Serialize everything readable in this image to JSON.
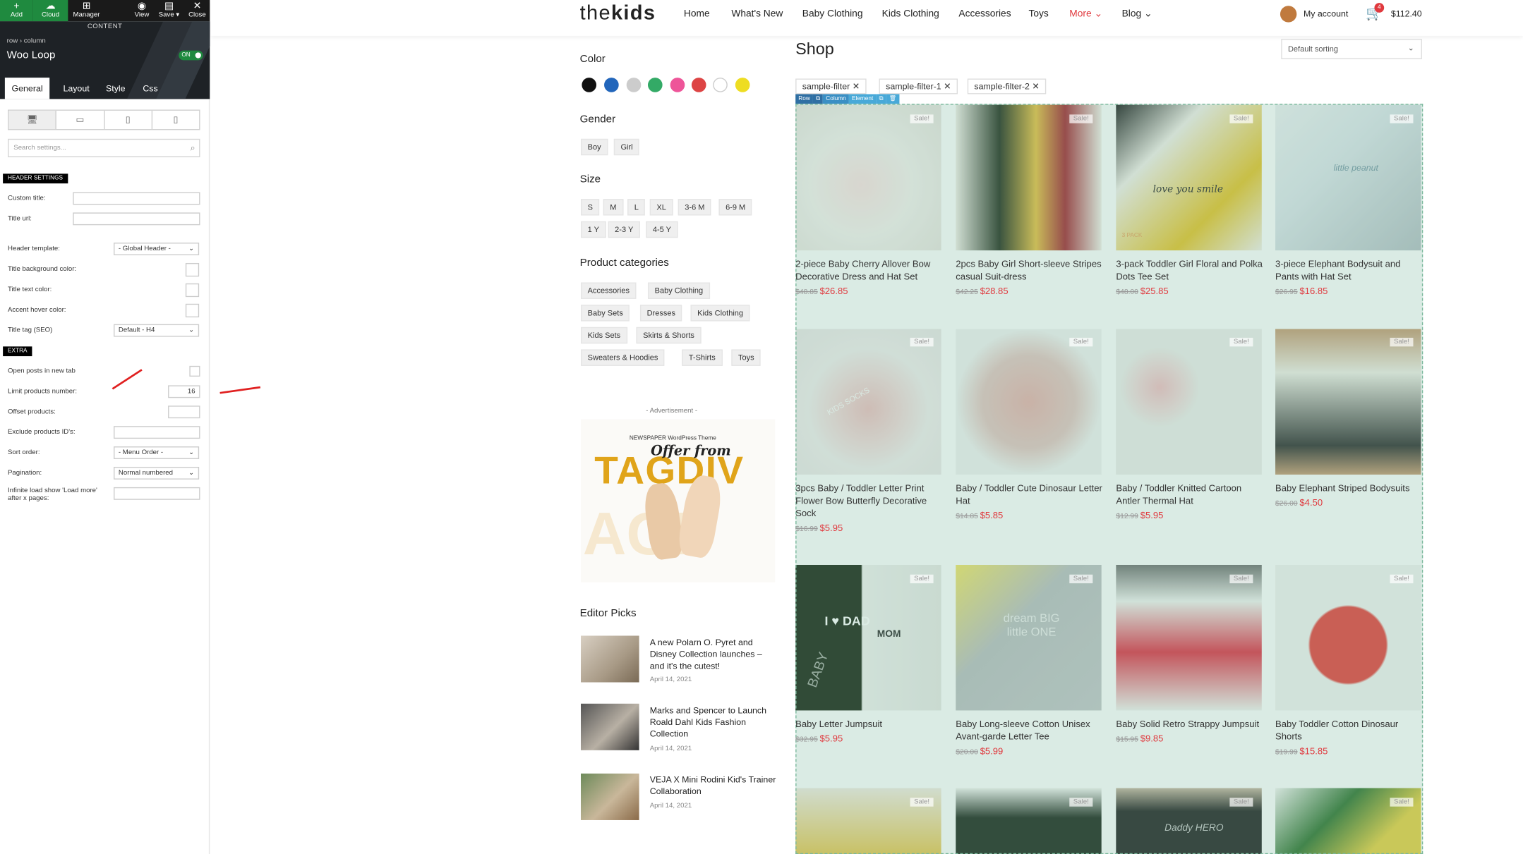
{
  "toolbar": {
    "add": "Add",
    "cloud": "Cloud",
    "manager": "Manager",
    "view": "View",
    "save": "Save ▾",
    "close": "Close"
  },
  "editor": {
    "content_label": "CONTENT",
    "breadcrumb": "row › column",
    "element_title": "Woo Loop",
    "toggle": "ON",
    "tabs": [
      "General",
      "Layout",
      "Style",
      "Css"
    ],
    "search_placeholder": "Search settings...",
    "header_section": "HEADER SETTINGS",
    "custom_title": "Custom title:",
    "title_url": "Title url:",
    "header_template": "Header template:",
    "header_template_value": "- Global Header -",
    "title_bg_color": "Title background color:",
    "title_text_color": "Title text color:",
    "accent_hover": "Accent hover color:",
    "title_tag": "Title tag (SEO)",
    "title_tag_value": "Default - H4",
    "extra_section": "EXTRA",
    "open_new_tab": "Open posts in new tab",
    "limit_products": "Limit products number:",
    "limit_products_value": "16",
    "offset_products": "Offset products:",
    "exclude_ids": "Exclude products ID's:",
    "sort_order": "Sort order:",
    "sort_order_value": "- Menu Order -",
    "pagination": "Pagination:",
    "pagination_value": "Normal numbered",
    "infinite_load": "Infinite load show 'Load more' after x pages:"
  },
  "site": {
    "logo_light": "the",
    "logo_bold": "kids",
    "nav": [
      "Home",
      "What's New",
      "Baby Clothing",
      "Kids Clothing",
      "Accessories",
      "Toys",
      "More",
      "Blog"
    ],
    "account": "My account",
    "cart_count": "4",
    "cart_total": "$112.40"
  },
  "sidebar": {
    "color_heading": "Color",
    "colors": [
      "#111111",
      "#2266bb",
      "#cccccc",
      "#33aa66",
      "#ee5599",
      "#dd4444",
      "#ffffff",
      "#eedd22"
    ],
    "gender_heading": "Gender",
    "genders": [
      "Boy",
      "Girl"
    ],
    "size_heading": "Size",
    "sizes_row1": [
      "S",
      "M",
      "L",
      "XL",
      "3-6 M",
      "6-9 M"
    ],
    "sizes_row2": [
      "1 Y",
      "2-3 Y",
      "4-5 Y"
    ],
    "categories_heading": "Product categories",
    "categories": [
      "Accessories",
      "Baby Clothing",
      "Baby Sets",
      "Dresses",
      "Kids Clothing",
      "Kids Sets",
      "Skirts & Shorts",
      "Sweaters & Hoodies",
      "T-Shirts",
      "Toys"
    ],
    "ad_label": "- Advertisement -",
    "ad_line1": "NEWSPAPER WordPress Theme",
    "ad_line2": "Offer from",
    "ad_line3": "TAGDIV",
    "ad_bg": "AGD",
    "editor_picks_heading": "Editor Picks",
    "editor_picks": [
      {
        "title": "A new Polarn O. Pyret and Disney Collection launches – and it's the cutest!",
        "date": "April 14, 2021"
      },
      {
        "title": "Marks and Spencer to Launch Roald Dahl Kids Fashion Collection",
        "date": "April 14, 2021"
      },
      {
        "title": "VEJA X Mini Rodini Kid's Trainer Collaboration",
        "date": "April 14, 2021"
      }
    ]
  },
  "shop": {
    "title": "Shop",
    "sorting": "Default sorting",
    "filters": [
      "sample-filter",
      "sample-filter-1",
      "sample-filter-2"
    ],
    "vc_bar": [
      "Row",
      "⧉",
      "Column",
      "Element",
      "⧉",
      "🗑"
    ],
    "sale_label": "Sale!",
    "pack_label": "3 PACK",
    "products": [
      {
        "name": "2-piece Baby Cherry Allover Bow Decorative Dress and Hat Set",
        "old": "$48.85",
        "new": "$26.85"
      },
      {
        "name": "2pcs Baby Girl Short-sleeve Stripes casual Suit-dress",
        "old": "$42.25",
        "new": "$28.85"
      },
      {
        "name": "3-pack Toddler Girl Floral and Polka Dots Tee Set",
        "old": "$48.00",
        "new": "$25.85"
      },
      {
        "name": "3-piece Elephant Bodysuit and Pants with Hat Set",
        "old": "$26.95",
        "new": "$16.85"
      },
      {
        "name": "3pcs Baby / Toddler Letter Print Flower Bow Butterfly Decorative Sock",
        "old": "$16.99",
        "new": "$5.95"
      },
      {
        "name": "Baby / Toddler Cute Dinosaur Letter Hat",
        "old": "$14.85",
        "new": "$5.85"
      },
      {
        "name": "Baby / Toddler Knitted Cartoon Antler Thermal Hat",
        "old": "$12.99",
        "new": "$5.95"
      },
      {
        "name": "Baby Elephant Striped Bodysuits",
        "old": "$26.00",
        "new": "$4.50"
      },
      {
        "name": "Baby Letter Jumpsuit",
        "old": "$32.95",
        "new": "$5.95"
      },
      {
        "name": "Baby Long-sleeve Cotton Unisex Avant-garde Letter Tee",
        "old": "$20.00",
        "new": "$5.99"
      },
      {
        "name": "Baby Solid Retro Strappy Jumpsuit",
        "old": "$15.95",
        "new": "$9.85"
      },
      {
        "name": "Baby Toddler Cotton Dinosaur Shorts",
        "old": "$19.99",
        "new": "$15.85"
      }
    ],
    "image_texts": [
      "love you smile",
      "little peanut",
      "KIDS SOCKS",
      "I ♥ DAD",
      "MOM",
      "dream BIG little ONE",
      "Daddy HERO",
      "BABY"
    ]
  }
}
